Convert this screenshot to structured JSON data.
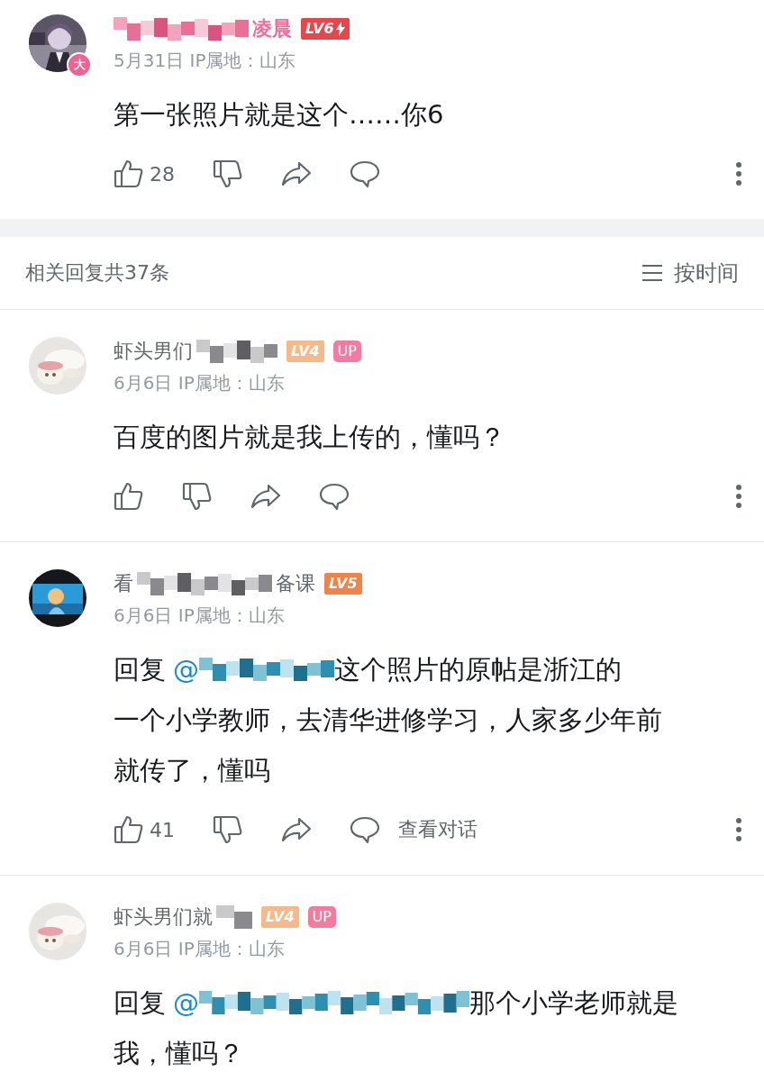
{
  "main_comment": {
    "user": {
      "vip_badge": "大",
      "vip": true,
      "name": [
        {
          "kind": "wide_mosaic"
        },
        {
          "kind": "text",
          "text": "凌晨"
        }
      ],
      "badges": [
        {
          "kind": "level",
          "label": "LV6",
          "color": "#e8464a",
          "flash": true
        }
      ]
    },
    "meta": "5月31日 IP属地：山东",
    "lines": [
      [
        {
          "kind": "text",
          "text": "第一张照片就是这个……你6"
        }
      ]
    ],
    "actions": {
      "kind": "bar",
      "likes": "28"
    }
  },
  "replies_header": {
    "count": "相关回复共37条",
    "sort": "按时间"
  },
  "replies": [
    {
      "user": {
        "vip": false,
        "name": [
          {
            "kind": "text",
            "text": "虾头男们"
          },
          {
            "kind": "mosaic"
          }
        ],
        "badges": [
          {
            "kind": "level",
            "label": "LV4",
            "color": "#f6b98a",
            "flash": false
          },
          {
            "kind": "up",
            "label": "UP",
            "color": "#f27ba0",
            "flash": false
          }
        ]
      },
      "meta": "6月6日 IP属地：山东",
      "lines": [
        [
          {
            "kind": "text",
            "text": "百度的图片就是我上传的，懂吗？"
          }
        ]
      ],
      "actions": {
        "kind": "bar"
      }
    },
    {
      "user": {
        "vip": false,
        "name": [
          {
            "kind": "text",
            "text": "看"
          },
          {
            "kind": "wide_mosaic"
          },
          {
            "kind": "text",
            "text": "备课"
          }
        ],
        "badges": [
          {
            "kind": "level",
            "label": "LV5",
            "color": "#f0834a",
            "flash": false
          }
        ]
      },
      "meta": "6月6日 IP属地：山东",
      "lines": [
        [
          {
            "kind": "reply",
            "text": "回复"
          },
          {
            "kind": "mention",
            "text": "@"
          },
          {
            "kind": "wide_mosaic"
          },
          {
            "kind": "text",
            "text": "这个照片的原帖是浙江的"
          }
        ],
        [
          {
            "kind": "text",
            "text": "一个小学教师，去清华进修学习，人家多少年前就传了，懂吗"
          }
        ]
      ],
      "actions": {
        "kind": "bar",
        "likes": "41",
        "dialog": "查看对话"
      }
    },
    {
      "user": {
        "vip": false,
        "name": [
          {
            "kind": "text",
            "text": "虾头男们就"
          },
          {
            "kind": "small_mosaic"
          }
        ],
        "badges": [
          {
            "kind": "level",
            "label": "LV4",
            "color": "#f6b98a",
            "flash": false
          },
          {
            "kind": "up",
            "label": "UP",
            "color": "#f27ba0",
            "flash": false
          }
        ]
      },
      "meta": "6月6日 IP属地：山东",
      "lines": [
        [
          {
            "kind": "reply",
            "text": "回复"
          },
          {
            "kind": "mention",
            "text": "@"
          },
          {
            "kind": "long_mosaic"
          },
          {
            "kind": "text",
            "text": "那个小学老师就是"
          }
        ],
        [
          {
            "kind": "text",
            "text": "我，懂吗？"
          }
        ]
      ]
    }
  ]
}
